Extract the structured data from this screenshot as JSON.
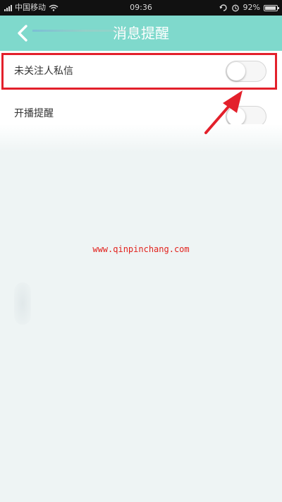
{
  "status_bar": {
    "carrier": "中国移动",
    "time": "09:36",
    "battery": "92%",
    "battery_level": 0.92
  },
  "header": {
    "title": "消息提醒",
    "back_icon": "chevron-left-icon",
    "background": "#7fd9cc"
  },
  "settings": [
    {
      "label": "未关注人私信",
      "enabled": false
    },
    {
      "label": "开播提醒",
      "enabled": false
    }
  ],
  "annotation": {
    "highlight_color": "#e3202b"
  },
  "watermark": "www.qinpinchang.com"
}
